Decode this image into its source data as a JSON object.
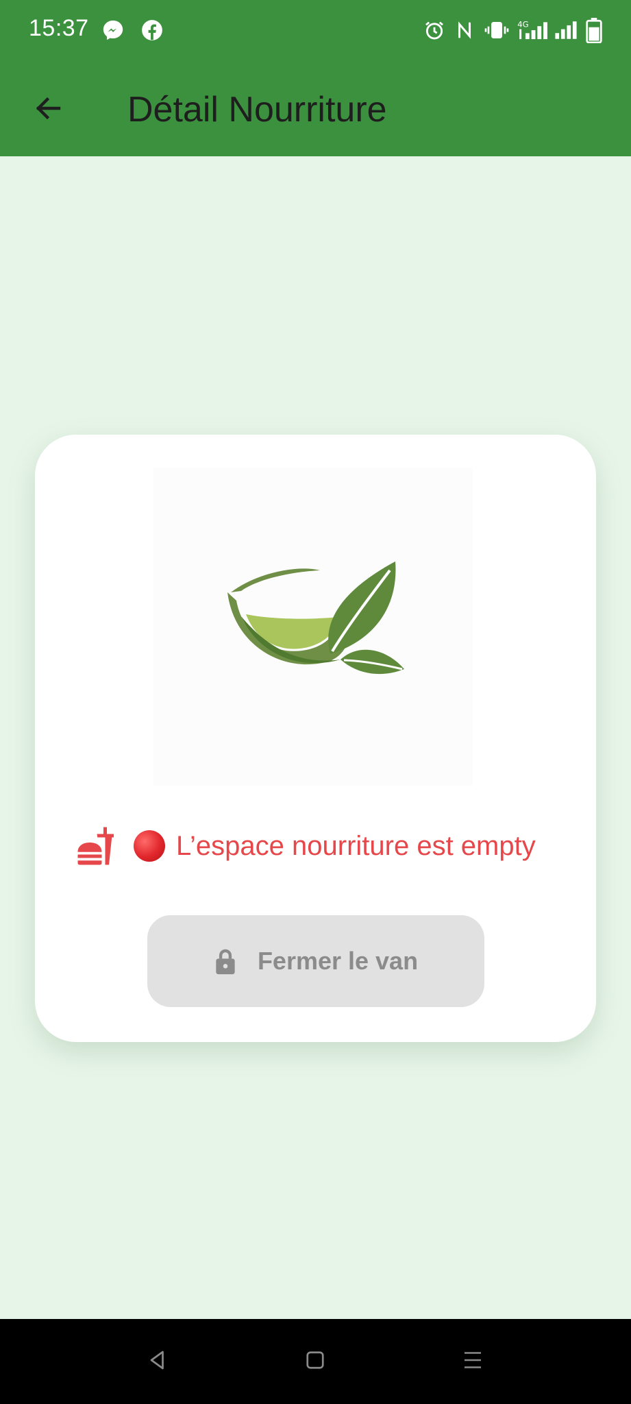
{
  "status_bar": {
    "time": "15:37",
    "left_icons": [
      "messenger-icon",
      "facebook-icon"
    ],
    "right_icons": [
      "alarm-icon",
      "nfc-icon",
      "vibrate-icon",
      "signal-4g-icon",
      "signal-icon",
      "battery-icon"
    ]
  },
  "app_bar": {
    "title": "Détail Nourriture",
    "back_icon": "arrow-left-icon"
  },
  "card": {
    "logo": "bowl-leaf-logo",
    "status_icon": "fastfood-icon",
    "status_dot": "red-circle",
    "status_text": "L’espace nourriture est empty",
    "button_label": "Fermer le van",
    "button_icon": "lock-icon",
    "button_disabled": true
  },
  "colors": {
    "primary": "#3c913f",
    "background": "#e7f5e8",
    "error": "#e5474a",
    "disabled_bg": "#e1e1e1",
    "disabled_text": "#8b8b8b"
  },
  "nav_bar": {
    "buttons": [
      "back-triangle-icon",
      "home-square-icon",
      "menu-lines-icon"
    ]
  }
}
